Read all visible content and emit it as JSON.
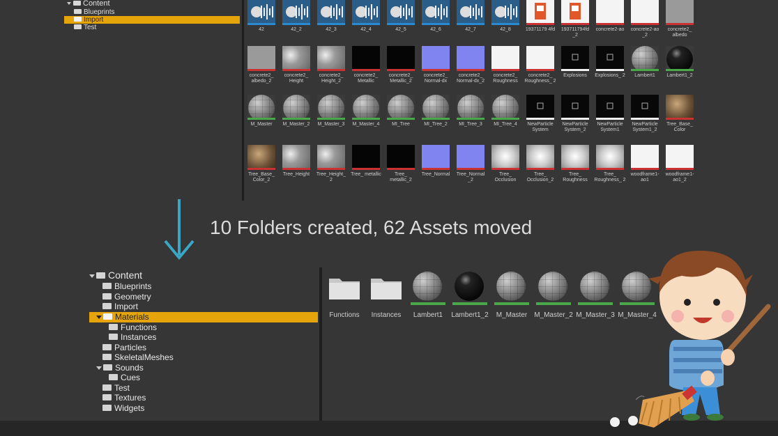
{
  "top_tree": {
    "items": [
      {
        "label": "Content",
        "expanded": true
      },
      {
        "label": "Blueprints"
      },
      {
        "label": "Import",
        "selected": true
      },
      {
        "label": "Test"
      }
    ]
  },
  "top_assets": [
    {
      "label": "42",
      "kind": "sound"
    },
    {
      "label": "42_2",
      "kind": "sound"
    },
    {
      "label": "42_3",
      "kind": "sound"
    },
    {
      "label": "42_4",
      "kind": "sound"
    },
    {
      "label": "42_5",
      "kind": "sound"
    },
    {
      "label": "42_6",
      "kind": "sound"
    },
    {
      "label": "42_7",
      "kind": "sound"
    },
    {
      "label": "42_8",
      "kind": "sound"
    },
    {
      "label": "19371179 4fd",
      "kind": "sprite"
    },
    {
      "label": "193711794fd _2",
      "kind": "sprite"
    },
    {
      "label": "concrete2-ao",
      "kind": "white"
    },
    {
      "label": "concrete2-ao _2",
      "kind": "white"
    },
    {
      "label": "concrete2_ albedo",
      "kind": "gray"
    },
    {
      "label": "concrete2_ albedo_2",
      "kind": "gray"
    },
    {
      "label": "concrete2_ Height",
      "kind": "noise"
    },
    {
      "label": "concrete2_ Height_2",
      "kind": "noise"
    },
    {
      "label": "concrete2_ Metallic",
      "kind": "black"
    },
    {
      "label": "concrete2_ Metallic_2",
      "kind": "black"
    },
    {
      "label": "concrete2_ Normal-dx",
      "kind": "normal"
    },
    {
      "label": "concrete2_ Normal-dx_2",
      "kind": "normal"
    },
    {
      "label": "concrete2_ Roughness",
      "kind": "white"
    },
    {
      "label": "concrete2_ Roughness_ 2",
      "kind": "white"
    },
    {
      "label": "Explosions",
      "kind": "particle"
    },
    {
      "label": "Explosions_ 2",
      "kind": "particle"
    },
    {
      "label": "Lambert1",
      "kind": "sphere"
    },
    {
      "label": "Lambert1_2",
      "kind": "spherebk"
    },
    {
      "label": "M_Master",
      "kind": "sphere"
    },
    {
      "label": "M_Master_2",
      "kind": "sphere"
    },
    {
      "label": "M_Master_3",
      "kind": "sphere"
    },
    {
      "label": "M_Master_4",
      "kind": "sphere"
    },
    {
      "label": "MI_Tree",
      "kind": "sphere"
    },
    {
      "label": "MI_Tree_2",
      "kind": "sphere"
    },
    {
      "label": "MI_Tree_3",
      "kind": "sphere"
    },
    {
      "label": "MI_Tree_4",
      "kind": "sphere"
    },
    {
      "label": "NewParticle System",
      "kind": "particle"
    },
    {
      "label": "NewParticle System_2",
      "kind": "particle"
    },
    {
      "label": "NewParticle System1",
      "kind": "particle"
    },
    {
      "label": "NewParticle System1_2",
      "kind": "particle"
    },
    {
      "label": "Tree_Base_ Color",
      "kind": "bark"
    },
    {
      "label": "Tree_Base_ Color_2",
      "kind": "bark"
    },
    {
      "label": "Tree_Height",
      "kind": "noise"
    },
    {
      "label": "Tree_Height_ 2",
      "kind": "noise"
    },
    {
      "label": "Tree_ metallic",
      "kind": "black"
    },
    {
      "label": "Tree_ metallic_2",
      "kind": "black"
    },
    {
      "label": "Tree_Normal",
      "kind": "normal"
    },
    {
      "label": "Tree_Normal _2",
      "kind": "normal"
    },
    {
      "label": "Tree_ Occlusion",
      "kind": "occl"
    },
    {
      "label": "Tree_ Occlusion_2",
      "kind": "occl"
    },
    {
      "label": "Tree_ Roughness",
      "kind": "occl"
    },
    {
      "label": "Tree_ Roughness_ 2",
      "kind": "occl"
    },
    {
      "label": "woodframe1- ao1",
      "kind": "white"
    },
    {
      "label": "woodframe1- ao1_2",
      "kind": "white"
    }
  ],
  "headline": "10 Folders created, 62 Assets moved",
  "bottom_tree": {
    "items": [
      {
        "label": "Content",
        "expanded": true
      },
      {
        "label": "Blueprints"
      },
      {
        "label": "Geometry"
      },
      {
        "label": "Import"
      },
      {
        "label": "Materials",
        "expanded": true,
        "selected": true
      },
      {
        "label": "Functions"
      },
      {
        "label": "Instances"
      },
      {
        "label": "Particles"
      },
      {
        "label": "SkeletalMeshes"
      },
      {
        "label": "Sounds",
        "expanded": true
      },
      {
        "label": "Cues"
      },
      {
        "label": "Test"
      },
      {
        "label": "Textures"
      },
      {
        "label": "Widgets"
      }
    ]
  },
  "bottom_assets": [
    {
      "label": "Functions",
      "kind": "folder"
    },
    {
      "label": "Instances",
      "kind": "folder"
    },
    {
      "label": "Lambert1",
      "kind": "sphere"
    },
    {
      "label": "Lambert1_2",
      "kind": "spherebk"
    },
    {
      "label": "M_Master",
      "kind": "sphere"
    },
    {
      "label": "M_Master_2",
      "kind": "sphere"
    },
    {
      "label": "M_Master_3",
      "kind": "sphere"
    },
    {
      "label": "M_Master_4",
      "kind": "sphere"
    }
  ],
  "colors": {
    "selection": "#e5a50a",
    "background": "#363636",
    "material_bar": "#4aa84a",
    "texture_bar": "#c83232",
    "sound_bar": "#2a8ad0"
  },
  "icons": {
    "arrow": "down-arrow-icon",
    "mascot": "sweeping-boy-illustration"
  }
}
